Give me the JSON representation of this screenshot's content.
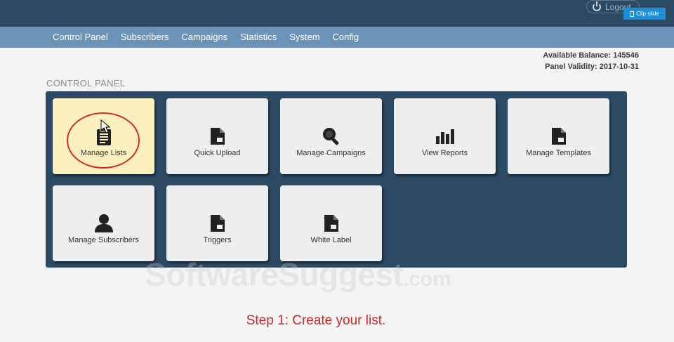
{
  "topbar": {
    "logout_label": "Logout",
    "clip_label": "Clip slide"
  },
  "nav": {
    "items": [
      "Control Panel",
      "Subscribers",
      "Campaigns",
      "Statistics",
      "System",
      "Config"
    ]
  },
  "account": {
    "balance_label": "Available Balance:",
    "balance_value": "145546",
    "validity_label": "Panel Validity:",
    "validity_value": "2017-10-31"
  },
  "section_title": "CONTROL PANEL",
  "tiles": [
    {
      "label": "Manage Lists",
      "icon": "clipboard-icon",
      "active": true
    },
    {
      "label": "Quick Upload",
      "icon": "file-icon"
    },
    {
      "label": "Manage Campaigns",
      "icon": "search-icon"
    },
    {
      "label": "View Reports",
      "icon": "bar-chart-icon"
    },
    {
      "label": "Manage Templates",
      "icon": "file-icon"
    },
    {
      "label": "Manage Subscribers",
      "icon": "user-icon"
    },
    {
      "label": "Triggers",
      "icon": "file-icon"
    },
    {
      "label": "White Label",
      "icon": "file-icon"
    }
  ],
  "watermark": {
    "main": "SoftwareSuggest",
    "suffix": ".com"
  },
  "caption": "Step 1: Create your list.",
  "colors": {
    "header_bg": "#2b4a63",
    "nav_bg": "#6b93b8",
    "panel_bg": "#2c4a63",
    "active_tile": "#fdf0bf",
    "caption": "#c62828"
  }
}
